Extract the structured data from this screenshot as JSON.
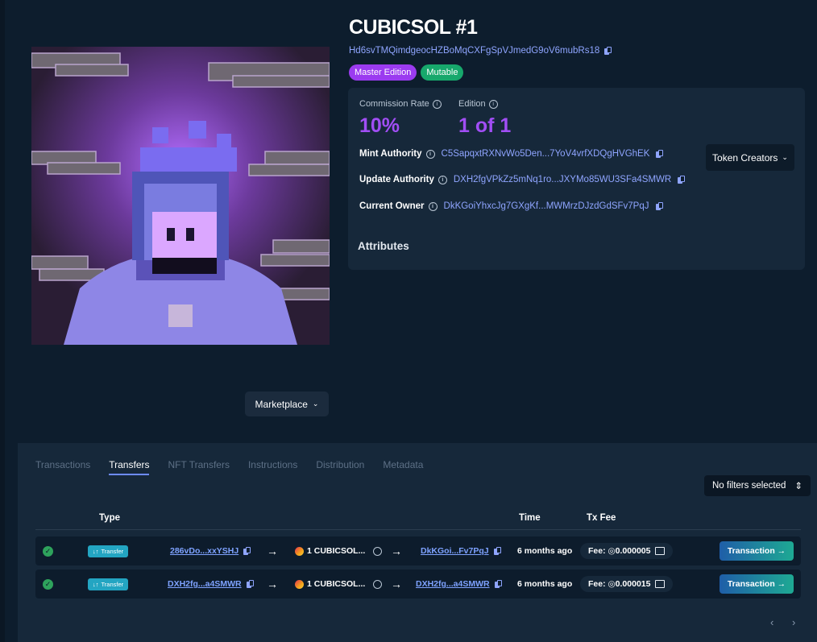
{
  "nft": {
    "title": "CUBICSOL #1",
    "mint_address": "Hd6svTMQimdgeocHZBoMqCXFgSpVJmedG9oV6mubRs18",
    "badges": [
      "Master Edition",
      "Mutable"
    ],
    "image_alt": "Pixel art character with purple hoodie and flaming hair"
  },
  "stats": {
    "commission_label": "Commission Rate",
    "commission_value": "10%",
    "edition_label": "Edition",
    "edition_value": "1 of 1"
  },
  "authorities": {
    "mint_label": "Mint Authority",
    "mint_value": "C5SapqxtRXNvWo5Den...7YoV4vrfXDQgHVGhEK",
    "update_label": "Update Authority",
    "update_value": "DXH2fgVPkZz5mNq1ro...JXYMo85WU3SFa4SMWR",
    "owner_label": "Current Owner",
    "owner_value": "DkKGoiYhxcJg7GXgKf...MWMrzDJzdGdSFv7PqJ"
  },
  "attributes_title": "Attributes",
  "token_creators_label": "Token Creators",
  "marketplace_label": "Marketplace",
  "tabs": [
    "Transactions",
    "Transfers",
    "NFT Transfers",
    "Instructions",
    "Distribution",
    "Metadata"
  ],
  "active_tab": "Transfers",
  "filter_label": "No filters selected",
  "table": {
    "headers": {
      "type": "Type",
      "time": "Time",
      "fee": "Tx Fee"
    },
    "rows": [
      {
        "status": "success",
        "type": "Transfer",
        "from": "286vDo...xxYSHJ",
        "token": "1 CUBICSOL...",
        "to": "DkKGoi...Fv7PqJ",
        "time": "6 months ago",
        "fee": "Fee: ◎0.000005",
        "button": "Transaction →"
      },
      {
        "status": "success",
        "type": "Transfer",
        "from": "DXH2fg...a4SMWR",
        "token": "1 CUBICSOL...",
        "to": "DXH2fg...a4SMWR",
        "time": "6 months ago",
        "fee": "Fee: ◎0.000015",
        "button": "Transaction →"
      }
    ]
  },
  "pagination": {
    "prev": "‹",
    "next": "›"
  },
  "colors": {
    "accent_purple": "#a14ef5",
    "link_blue": "#8fa5ff",
    "success": "#2ea35c",
    "transfer_badge": "#23a5c2"
  }
}
